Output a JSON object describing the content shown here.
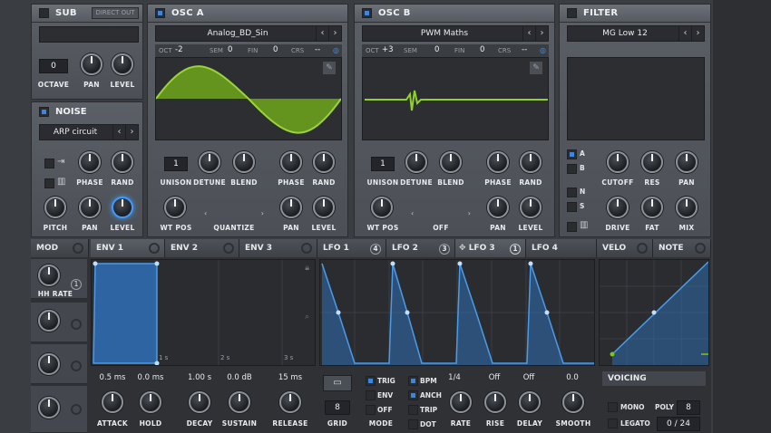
{
  "sub": {
    "title": "SUB",
    "direct_out": "DIRECT OUT",
    "octave_value": "0",
    "octave_label": "OCTAVE",
    "pan_label": "PAN",
    "level_label": "LEVEL"
  },
  "noise": {
    "title": "NOISE",
    "preset": "ARP circuit",
    "phase_label": "PHASE",
    "rand_label": "RAND",
    "pitch_label": "PITCH",
    "pan_label": "PAN",
    "level_label": "LEVEL"
  },
  "osc_a": {
    "title": "OSC A",
    "preset": "Analog_BD_Sin",
    "oct_label": "OCT",
    "oct_value": "-2",
    "sem_label": "SEM",
    "sem_value": "0",
    "fin_label": "FIN",
    "fin_value": "0",
    "crs_label": "CRS",
    "crs_value": "--",
    "unison_value": "1",
    "unison_label": "UNISON",
    "detune_label": "DETUNE",
    "blend_label": "BLEND",
    "phase_label": "PHASE",
    "rand_label": "RAND",
    "wtpos_label": "WT POS",
    "quantize_label": "QUANTIZE",
    "pan_label": "PAN",
    "level_label": "LEVEL"
  },
  "osc_b": {
    "title": "OSC B",
    "preset": "PWM Maths",
    "oct_label": "OCT",
    "oct_value": "+3",
    "sem_label": "SEM",
    "sem_value": "0",
    "fin_label": "FIN",
    "fin_value": "0",
    "crs_label": "CRS",
    "crs_value": "--",
    "unison_value": "1",
    "unison_label": "UNISON",
    "detune_label": "DETUNE",
    "blend_label": "BLEND",
    "phase_label": "PHASE",
    "rand_label": "RAND",
    "wtpos_label": "WT POS",
    "warp_label": "OFF",
    "pan_label": "PAN",
    "level_label": "LEVEL"
  },
  "filter": {
    "title": "FILTER",
    "preset": "MG Low 12",
    "route_a": "A",
    "route_b": "B",
    "route_n": "N",
    "route_s": "S",
    "cutoff_label": "CUTOFF",
    "res_label": "RES",
    "pan_label": "PAN",
    "drive_label": "DRIVE",
    "fat_label": "FAT",
    "mix_label": "MIX"
  },
  "mod": {
    "title": "MOD",
    "hh_rate_label": "HH RATE",
    "hh_rate_badge": "1"
  },
  "env_tabs": [
    "ENV 1",
    "ENV 2",
    "ENV 3"
  ],
  "lfo_tabs": [
    {
      "label": "LFO 1",
      "badge": "4"
    },
    {
      "label": "LFO 2",
      "badge": "3"
    },
    {
      "label": "LFO 3",
      "badge": "1"
    },
    {
      "label": "LFO 4",
      "badge": ""
    }
  ],
  "velo_tabs": [
    "VELO",
    "NOTE"
  ],
  "env_timeline": [
    "1 s",
    "2 s",
    "3 s"
  ],
  "env_params": [
    {
      "value": "0.5 ms",
      "label": "ATTACK"
    },
    {
      "value": "0.0 ms",
      "label": "HOLD"
    },
    {
      "value": "1.00 s",
      "label": "DECAY"
    },
    {
      "value": "0.0 dB",
      "label": "SUSTAIN"
    },
    {
      "value": "15 ms",
      "label": "RELEASE"
    }
  ],
  "lfo": {
    "grid_value": "8",
    "grid_label": "GRID",
    "mode_label": "MODE",
    "trig": "TRIG",
    "env": "ENV",
    "off": "OFF",
    "bpm": "BPM",
    "anch": "ANCH",
    "trip": "TRIP",
    "dot": "DOT",
    "rate_value": "1/4",
    "rate_label": "RATE",
    "rise_value": "Off",
    "rise_label": "RISE",
    "delay_value": "Off",
    "delay_label": "DELAY",
    "smooth_value": "0.0",
    "smooth_label": "SMOOTH"
  },
  "voicing": {
    "title": "VOICING",
    "mono": "MONO",
    "poly": "POLY",
    "poly_value": "8",
    "legato": "LEGATO",
    "legato_value": "0 / 24"
  },
  "colors": {
    "accent": "#3f86d8",
    "wave_green": "#7fc31c",
    "lfo_blue": "#3d8fd9"
  }
}
